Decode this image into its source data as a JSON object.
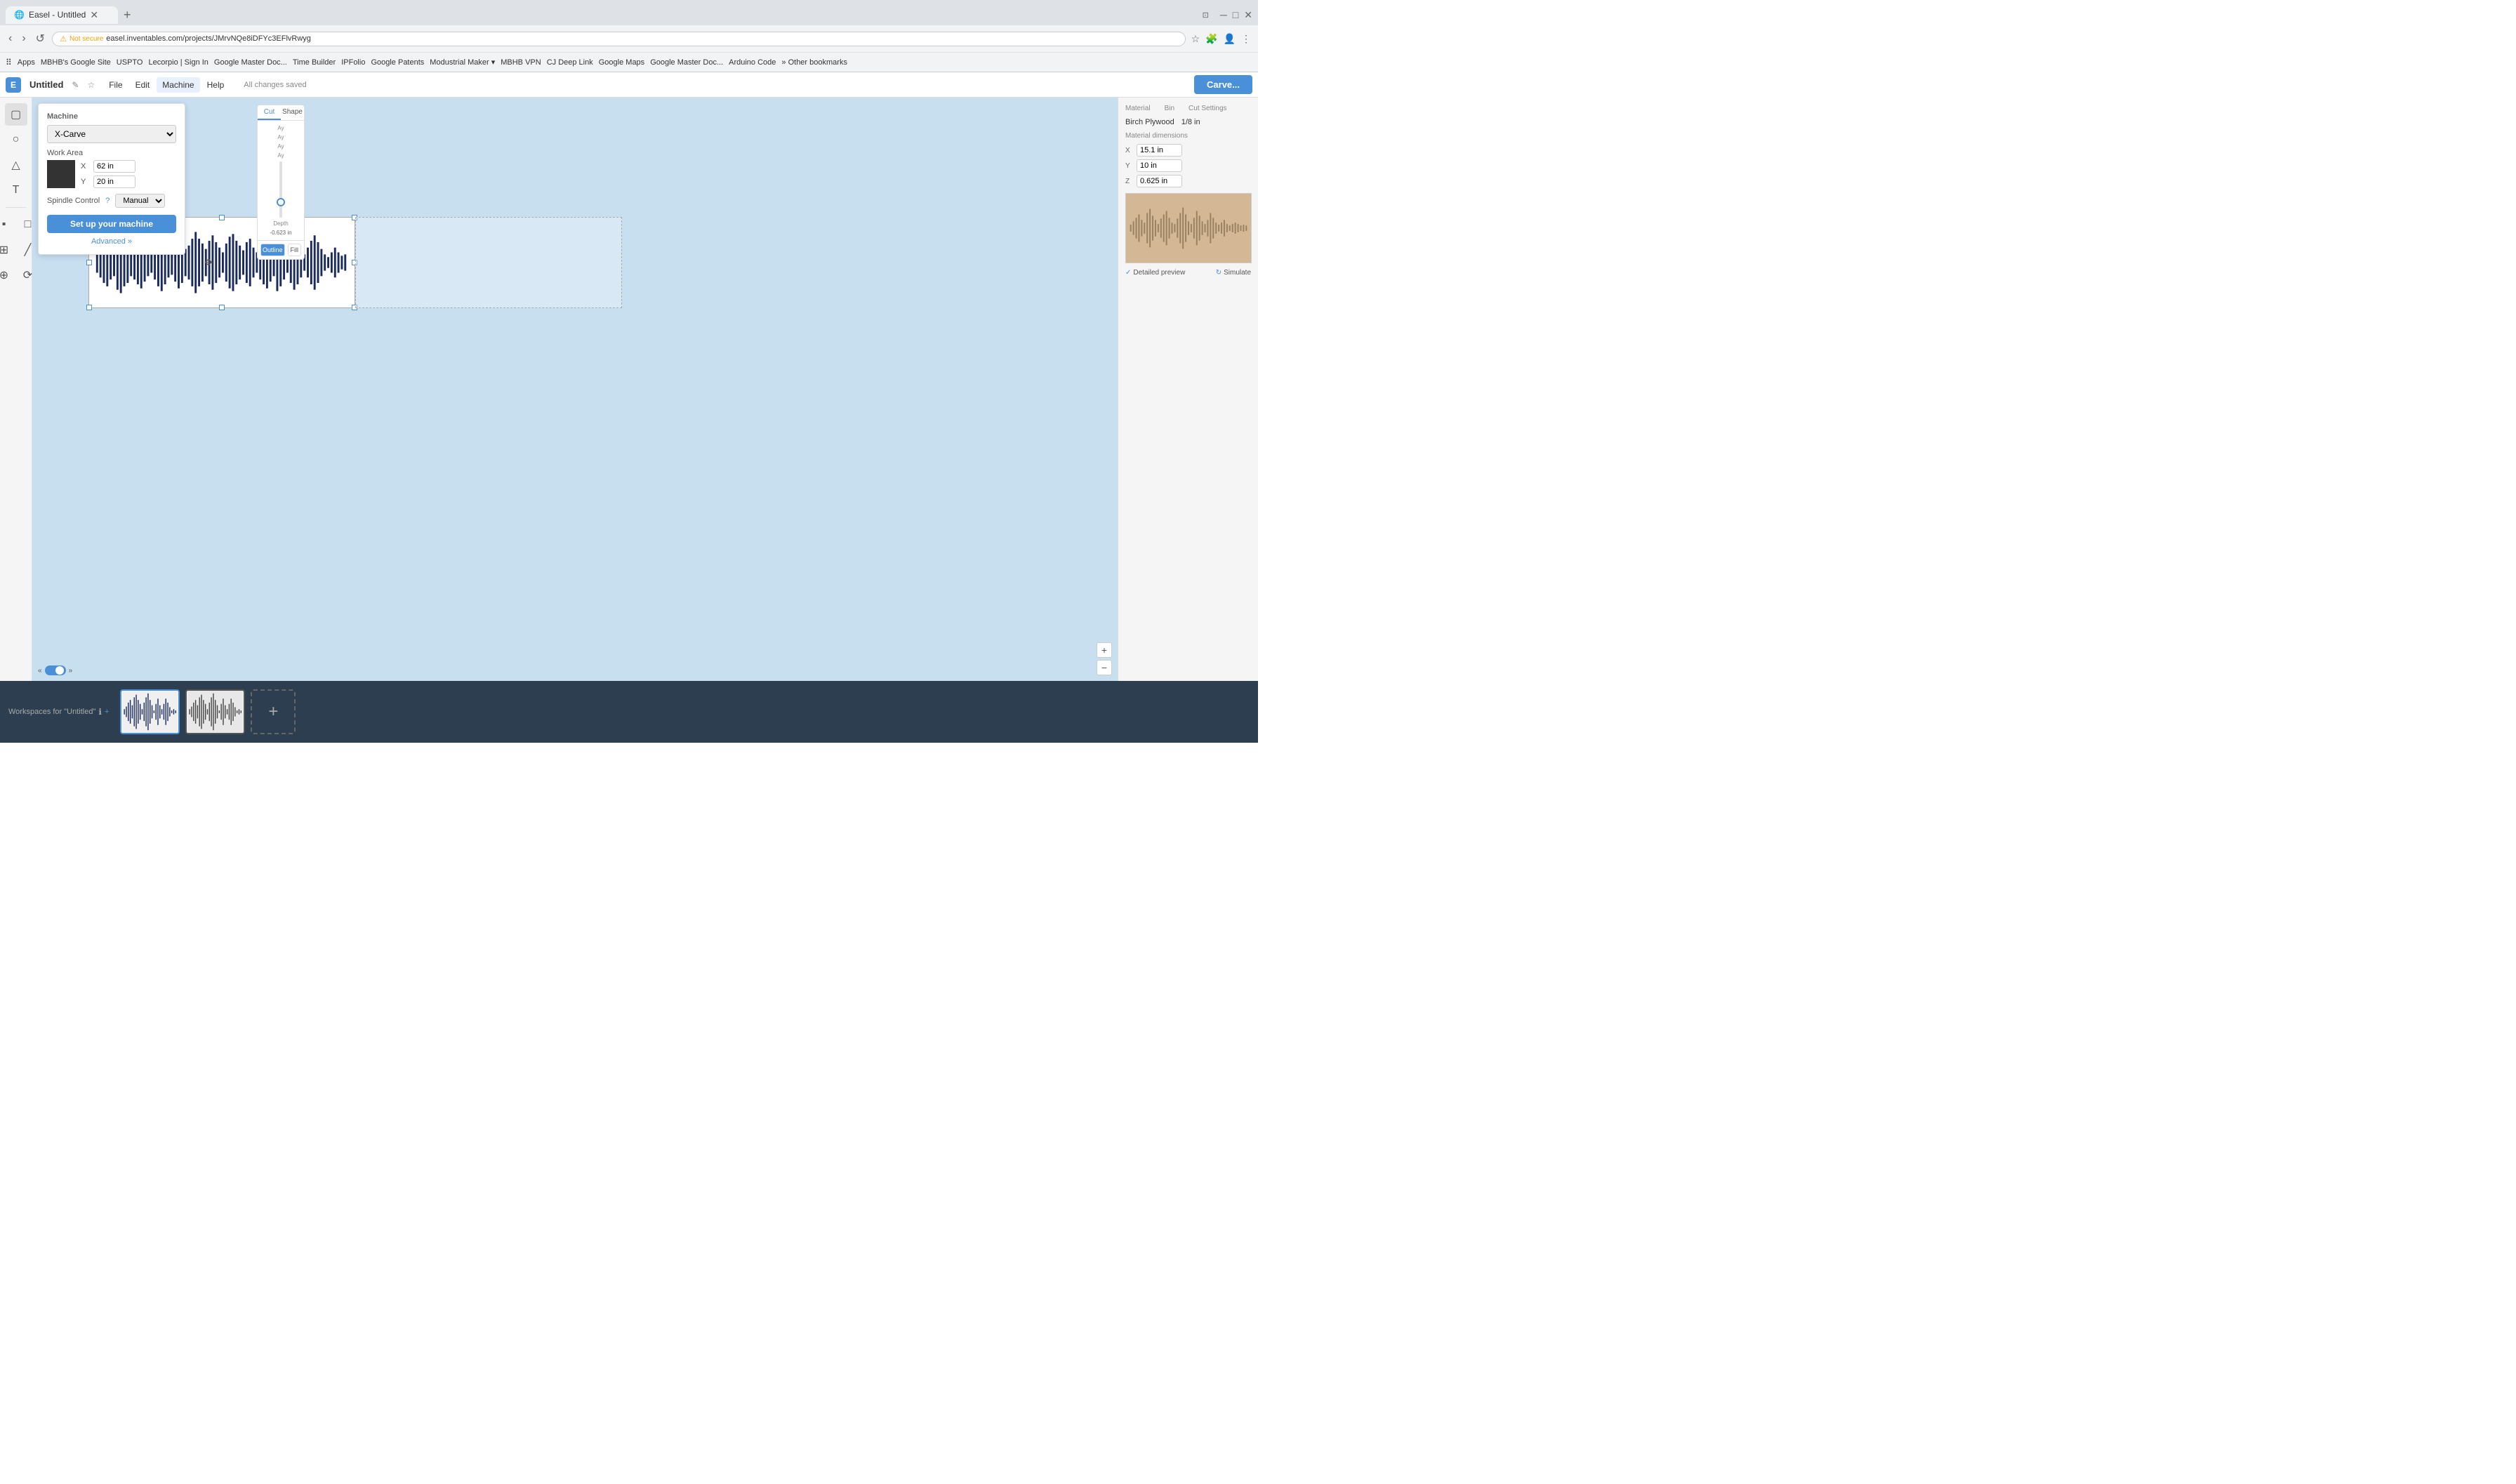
{
  "browser": {
    "tab_title": "Easel - Untitled",
    "address": "easel.inventables.com/projects/JMrvNQe8iDFYc3EFlvRwyg",
    "protocol": "Not secure",
    "bookmarks": [
      "Apps",
      "MBHB's Google Site",
      "USPTO",
      "Lecorpio | Sign In",
      "Google Master Doc...",
      "Time Builder",
      "IPFolio",
      "Google Patents",
      "Modustrial Maker",
      "MBHB VPN",
      "CJ Deep Link",
      "Google Maps",
      "Google Master Doc...",
      "Arduino Code",
      "Other bookmarks"
    ]
  },
  "app": {
    "title": "Untitled",
    "menu": [
      "File",
      "Edit",
      "Machine",
      "Help"
    ],
    "save_status": "All changes saved",
    "carve_button": "Carve...",
    "machine_active": "Machine"
  },
  "machine_panel": {
    "title": "Machine",
    "machine_type": "X-Carve",
    "work_area_label": "Work Area",
    "x_label": "X",
    "x_value": "62 in",
    "y_label": "Y",
    "y_value": "20 in",
    "spindle_label": "Spindle Control",
    "spindle_value": "Manual",
    "setup_button": "Set up your machine",
    "advanced_link": "Advanced »"
  },
  "cut_panel": {
    "cut_tab": "Cut",
    "shape_tab": "Shape",
    "depth_label": "Depth",
    "depth_value": "-0.623 in",
    "outline_label": "Outline",
    "fill_label": "Fill"
  },
  "right_panel": {
    "material_label": "Material",
    "bin_label": "Bin",
    "material_value": "Birch Plywood",
    "bin_value": "1/8 in",
    "material_dimensions_label": "Material dimensions",
    "x_label": "X",
    "x_value": "15.1 in",
    "y_label": "Y",
    "y_value": "10 in",
    "z_label": "Z",
    "z_value": "0.625 in"
  },
  "bottom_bar": {
    "detail_preview": "Detailed preview",
    "simulate": "Simulate"
  },
  "workspaces": {
    "label": "Workspaces for \"Untitled\"",
    "info_icon": "ℹ",
    "add_label": "+",
    "items": [
      {
        "id": 1,
        "active": true
      },
      {
        "id": 2,
        "active": false
      },
      {
        "id": 3,
        "add": true
      }
    ]
  },
  "zoom": {
    "in_label": "+",
    "out_label": "-",
    "toggle_left": "«",
    "toggle_right": "»"
  }
}
